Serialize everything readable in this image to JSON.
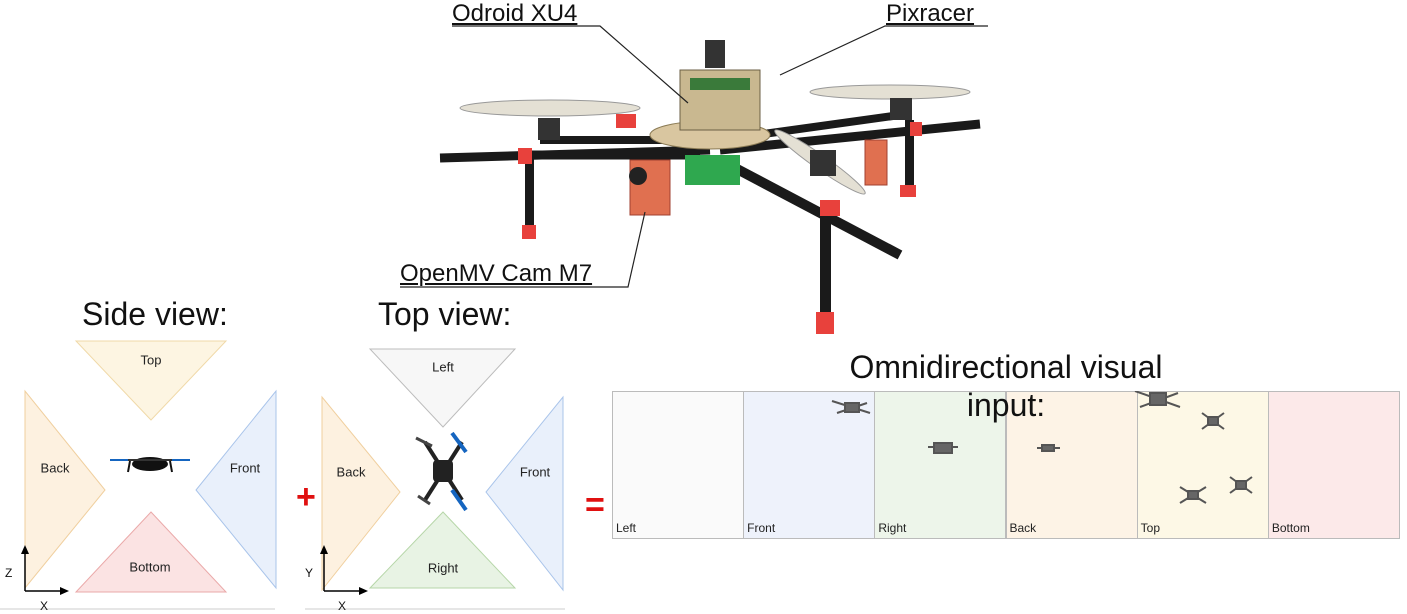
{
  "callouts": {
    "odroid": "Odroid XU4",
    "pixracer": "Pixracer",
    "openmv": "OpenMV Cam M7"
  },
  "side_view": {
    "title": "Side view:",
    "top": "Top",
    "back": "Back",
    "front": "Front",
    "bottom": "Bottom",
    "axis_vertical": "Z",
    "axis_horizontal": "X"
  },
  "top_view": {
    "title": "Top view:",
    "left": "Left",
    "back": "Back",
    "front": "Front",
    "right": "Right",
    "axis_vertical": "Y",
    "axis_horizontal": "X"
  },
  "operators": {
    "plus": "+",
    "equals": "="
  },
  "omni": {
    "title_line1": "Omnidirectional visual",
    "title_line2": "input:",
    "cells": [
      {
        "label": "Left",
        "color": "#fafafa"
      },
      {
        "label": "Front",
        "color": "#eef2fb"
      },
      {
        "label": "Right",
        "color": "#edf5ea"
      },
      {
        "label": "Back",
        "color": "#fdf3e6"
      },
      {
        "label": "Top",
        "color": "#fdf8e6"
      },
      {
        "label": "Bottom",
        "color": "#fce9e9"
      }
    ]
  },
  "colors": {
    "top": "#fdf5e2",
    "back": "#fdf1e0",
    "front": "#e9f0fb",
    "bottom": "#fbe3e3",
    "left": "#f7f7f7",
    "right": "#e8f3e4",
    "accent_red": "#e01010"
  }
}
